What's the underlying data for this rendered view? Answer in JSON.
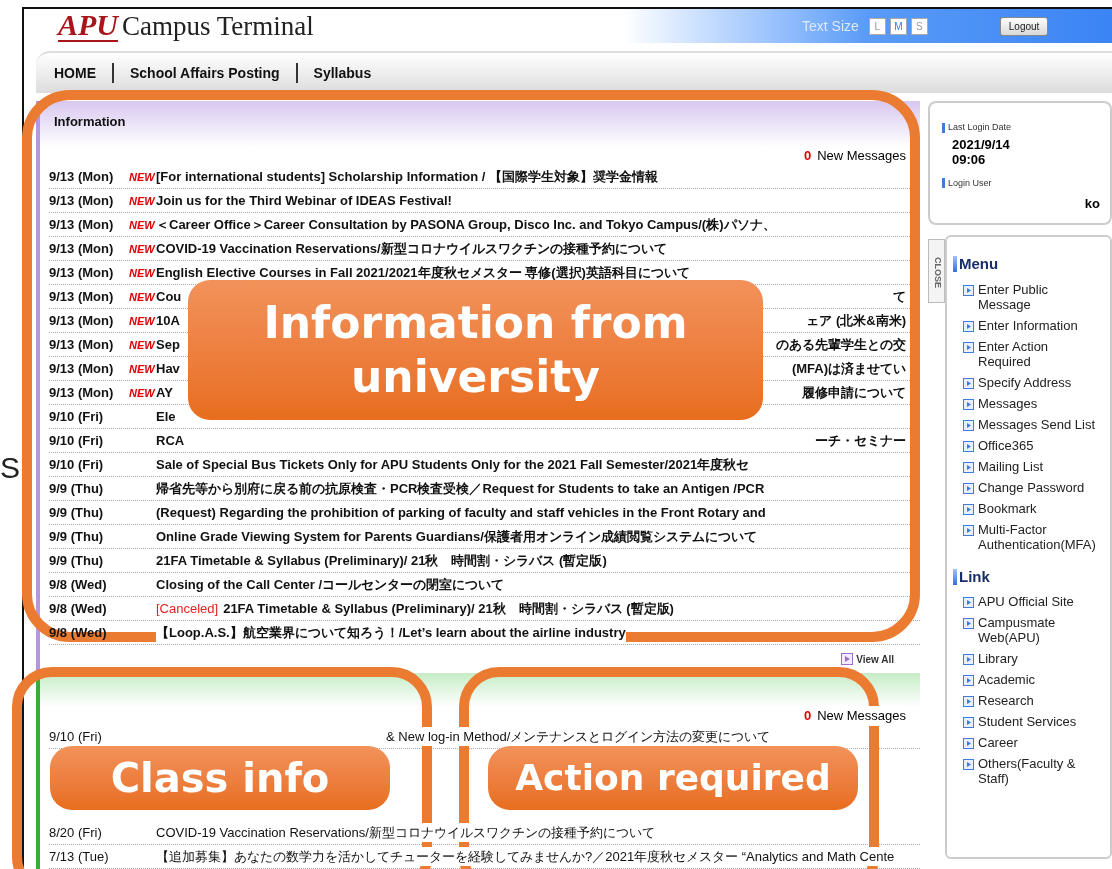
{
  "stray_text": "S",
  "header": {
    "logo": "APU",
    "title": "Campus Terminal",
    "text_size_label": "Text Size",
    "text_sizes": [
      {
        "label": "L",
        "selected": false
      },
      {
        "label": "M",
        "selected": true
      },
      {
        "label": "S",
        "selected": false
      }
    ],
    "logout": "Logout"
  },
  "nav": [
    "HOME",
    "School Affairs Posting",
    "Syllabus"
  ],
  "information": {
    "title": "Information",
    "new_count": "0",
    "new_label": "New Messages",
    "view_all": "View All",
    "rows": [
      {
        "date": "9/13 (Mon)",
        "badge": "NEW",
        "text": "[For international students] Scholarship Information / 【国際学生対象】奨学金情報"
      },
      {
        "date": "9/13 (Mon)",
        "badge": "NEW",
        "text": "Join us for the Third Webinar of IDEAS Festival!"
      },
      {
        "date": "9/13 (Mon)",
        "badge": "NEW",
        "text": "＜Career Office＞Career Consultation by PASONA Group, Disco Inc. and Tokyo Campus/(株)パソナ、"
      },
      {
        "date": "9/13 (Mon)",
        "badge": "NEW",
        "text": "COVID-19 Vaccination Reservations/新型コロナウイルスワクチンの接種予約について"
      },
      {
        "date": "9/13 (Mon)",
        "badge": "NEW",
        "text": "English Elective Courses in Fall 2021/2021年度秋セメスター 専修(選択)英語科目について"
      },
      {
        "date": "9/13 (Mon)",
        "badge": "NEW",
        "text": "Cou",
        "tail": "て"
      },
      {
        "date": "9/13 (Mon)",
        "badge": "NEW",
        "text": "10A",
        "tail": "ェア (北米&南米)"
      },
      {
        "date": "9/13 (Mon)",
        "badge": "NEW",
        "text": "Sep",
        "tail": "のある先輩学生との交"
      },
      {
        "date": "9/13 (Mon)",
        "badge": "NEW",
        "text": "Hav",
        "tail": "(MFA)は済ませてい"
      },
      {
        "date": "9/13 (Mon)",
        "badge": "NEW",
        "text": "AY",
        "tail": "履修申請について"
      },
      {
        "date": "9/10 (Fri)",
        "text": "Ele"
      },
      {
        "date": "9/10 (Fri)",
        "text": "RCA",
        "tail": "ーチ・セミナー"
      },
      {
        "date": "9/10 (Fri)",
        "text": "Sale of Special Bus Tickets Only for APU Students Only for the 2021 Fall Semester/2021年度秋セ"
      },
      {
        "date": "9/9 (Thu)",
        "text": "帰省先等から別府に戻る前の抗原検査・PCR検査受検／Request for Students to take an Antigen /PCR"
      },
      {
        "date": "9/9 (Thu)",
        "text": "(Request) Regarding the prohibition of parking of faculty and staff vehicles in the Front Rotary and"
      },
      {
        "date": "9/9 (Thu)",
        "text": "Online Grade Viewing System for Parents Guardians/保護者用オンライン成績閲覧システムについて"
      },
      {
        "date": "9/9 (Thu)",
        "text": "21FA Timetable & Syllabus (Preliminary)/ 21秋　時間割・シラバス (暫定版)"
      },
      {
        "date": "9/8 (Wed)",
        "text": "Closing of the Call Center /コールセンターの閉室について"
      },
      {
        "date": "9/8 (Wed)",
        "tag": "[Canceled]",
        "text": "21FA Timetable & Syllabus (Preliminary)/ 21秋　時間割・シラバス (暫定版)"
      },
      {
        "date": "9/8 (Wed)",
        "text": "【Loop.A.S.】航空業界について知ろう！/Let’s learn about the airline industry"
      }
    ]
  },
  "action_required": {
    "new_count": "0",
    "new_label": "New Messages",
    "rows": [
      {
        "date": "9/10 (Fri)",
        "text": "& New log-in Method/メンテナンスとログイン方法の変更について"
      },
      {
        "date": "8/20 (Fri)",
        "text": "COVID-19 Vaccination Reservations/新型コロナウイルスワクチンの接種予約について"
      },
      {
        "date": "7/13 (Tue)",
        "text": "【追加募集】あなたの数学力を活かしてチューターを経験してみませんか?／2021年度秋セメスター “Analytics and Math Cente"
      }
    ]
  },
  "login": {
    "date_label": "Last Login Date",
    "date": "2021/9/14",
    "time": "09:06",
    "user_label": "Login User",
    "user": "ko"
  },
  "close_tab": "CLOSE",
  "menu": {
    "title": "Menu",
    "items": [
      "Enter Public Message",
      "Enter Information",
      "Enter Action Required",
      "Specify Address",
      "Messages",
      "Messages Send List",
      "Office365",
      "Mailing List",
      "Change Password",
      "Bookmark",
      "Multi-Factor Authentication(MFA)"
    ]
  },
  "links": {
    "title": "Link",
    "items": [
      "APU Official Site",
      "Campusmate Web(APU)",
      "Library",
      "Academic",
      "Research",
      "Student Services",
      "Career",
      "Others(Faculty & Staff)"
    ]
  },
  "annotations": [
    {
      "text": "Information from university"
    },
    {
      "text": "Class info"
    },
    {
      "text": "Action required"
    }
  ]
}
